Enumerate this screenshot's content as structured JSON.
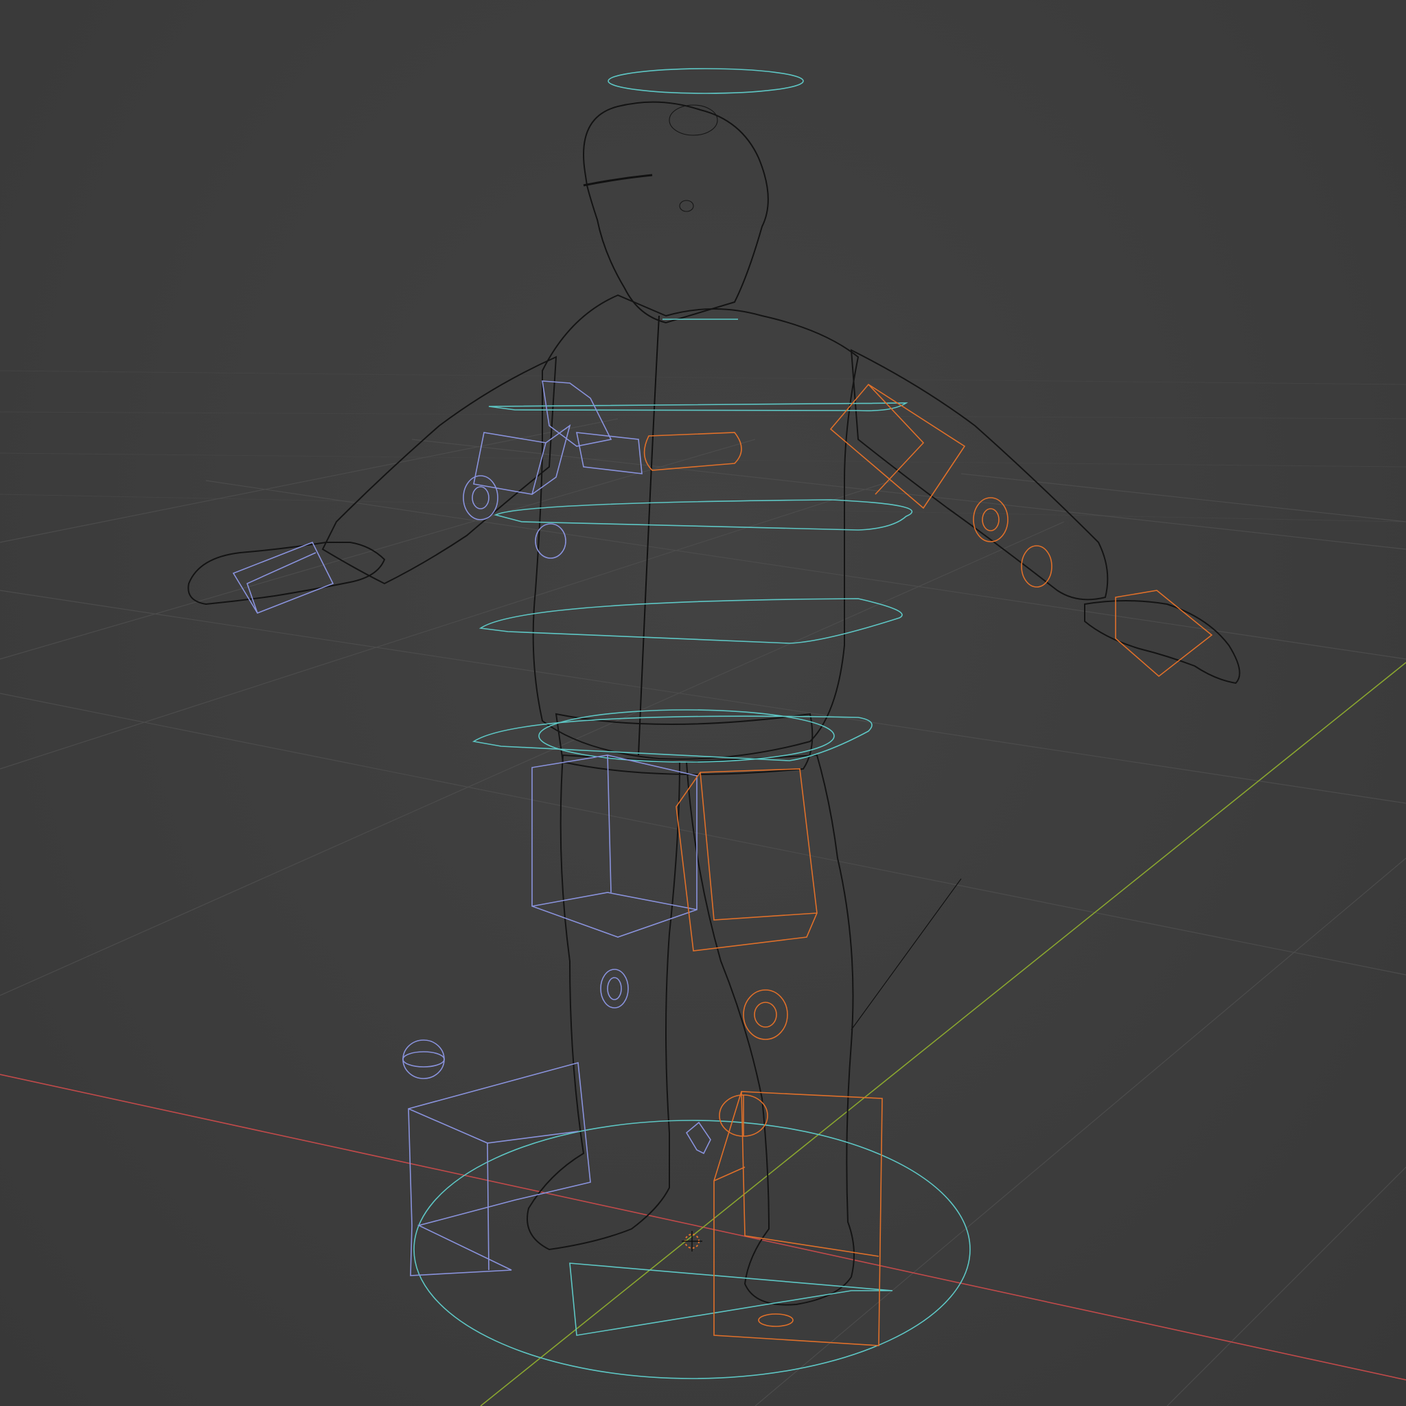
{
  "viewport": {
    "editor": "3d-viewport",
    "shading_mode": "wireframe",
    "colors": {
      "background": "#3d3d3d",
      "grid": "#4c4c4c",
      "mesh_wire": "#151515",
      "axis_x": "#d05050",
      "axis_y": "#8aa630",
      "controls_center": "#5ec7c5",
      "controls_left": "#8a93dd",
      "controls_right": "#e0702a",
      "cursor": "#e0702a"
    }
  },
  "scene": {
    "object": "character-mesh",
    "rig": "armature-controls",
    "pose": "T-pose"
  }
}
